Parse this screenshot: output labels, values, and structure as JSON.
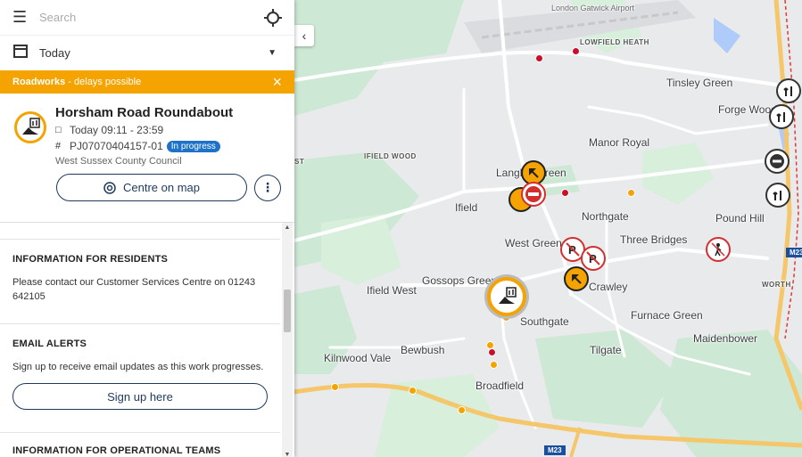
{
  "search": {
    "placeholder": "Search"
  },
  "date": {
    "value": "Today"
  },
  "alert": {
    "title": "Roadworks",
    "message": "- delays possible"
  },
  "incident": {
    "title": "Horsham Road Roundabout",
    "time": "Today 09:11 - 23:59",
    "reference": "PJ07070404157-01",
    "status": "In progress",
    "organisation": "West Sussex County Council",
    "centre_label": "Centre on map"
  },
  "sections": {
    "residents_title": "INFORMATION FOR RESIDENTS",
    "residents_text": "Please contact our Customer Services Centre on 01243 642105",
    "email_title": "EMAIL ALERTS",
    "email_text": "Sign up to receive email updates as this work progresses.",
    "signup_label": "Sign up here",
    "operational_title": "INFORMATION FOR OPERATIONAL TEAMS"
  },
  "map": {
    "places": {
      "airport": "London Gatwick Airport",
      "lowfield": "LOWFIELD HEATH",
      "tinsley": "Tinsley Green",
      "forge": "Forge Wood",
      "manor": "Manor Royal",
      "ifield_wood": "IFIELD WOOD",
      "langley": "Langley Green",
      "ifield": "Ifield",
      "northgate": "Northgate",
      "pound": "Pound Hill",
      "west_green": "West Green",
      "three_bridges": "Three Bridges",
      "gossops": "Gossops Green",
      "ifield_west": "Ifield West",
      "crawley": "Crawley",
      "southgate": "Southgate",
      "furnace": "Furnace Green",
      "maidenbower": "Maidenbower",
      "bewbush": "Bewbush",
      "kilnwood": "Kilnwood Vale",
      "tilgate": "Tilgate",
      "broadfield": "Broadfield",
      "worth": "WORTH",
      "st": "ST"
    },
    "roads": {
      "m23": "M23",
      "m23b": "M23"
    }
  },
  "colors": {
    "accent": "#f4a300",
    "badge": "#1e73c8",
    "navy": "#1d3a5c"
  }
}
